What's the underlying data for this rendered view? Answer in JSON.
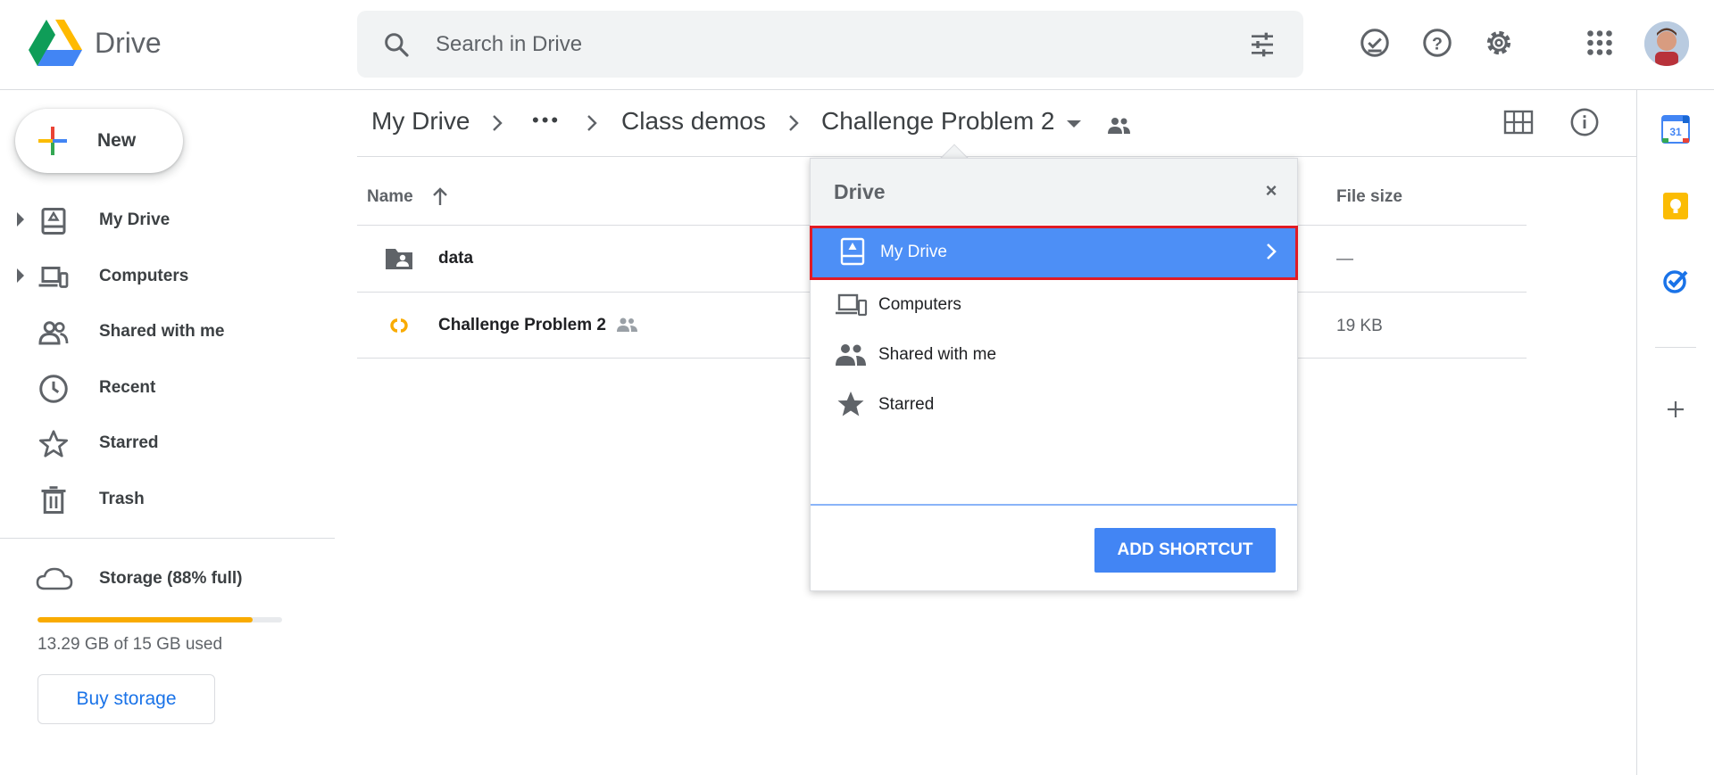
{
  "header": {
    "app_name": "Drive",
    "search_placeholder": "Search in Drive",
    "icons": [
      "drive-logo",
      "search-icon",
      "tune-icon",
      "ready-for-offline-icon",
      "help-icon",
      "settings-icon",
      "apps-grid-icon",
      "avatar"
    ]
  },
  "sidebar": {
    "new_label": "New",
    "items": [
      {
        "label": "My Drive",
        "icon": "my-drive-icon"
      },
      {
        "label": "Computers",
        "icon": "computers-icon"
      },
      {
        "label": "Shared with me",
        "icon": "shared-with-me-icon"
      },
      {
        "label": "Recent",
        "icon": "clock-icon"
      },
      {
        "label": "Starred",
        "icon": "star-outline-icon"
      },
      {
        "label": "Trash",
        "icon": "trash-icon"
      }
    ],
    "storage_label": "Storage (88% full)",
    "storage_percent": 88,
    "storage_used": "13.29 GB of 15 GB used",
    "buy_storage": "Buy storage"
  },
  "breadcrumb": {
    "items": [
      "My Drive",
      "•••",
      "Class demos",
      "Challenge Problem 2"
    ]
  },
  "file_list": {
    "columns": {
      "name": "Name",
      "size": "File size"
    },
    "rows": [
      {
        "name": "data",
        "type": "shared-folder",
        "size": "—",
        "shared": false
      },
      {
        "name": "Challenge Problem 2",
        "type": "colab",
        "size": "19 KB",
        "shared": true
      }
    ]
  },
  "popup": {
    "title": "Drive",
    "close": "×",
    "items": [
      {
        "label": "My Drive",
        "icon": "my-drive-icon",
        "selected": true
      },
      {
        "label": "Computers",
        "icon": "computers-icon",
        "selected": false
      },
      {
        "label": "Shared with me",
        "icon": "shared-with-me-icon",
        "selected": false
      },
      {
        "label": "Starred",
        "icon": "star-icon",
        "selected": false
      }
    ],
    "add_shortcut": "ADD SHORTCUT"
  },
  "right_rail": {
    "icons": [
      "calendar-icon",
      "keep-icon",
      "tasks-icon",
      "add-addon-icon"
    ],
    "calendar_day": "31"
  },
  "colors": {
    "accent_blue": "#1a73e8",
    "selected_row": "#4d8ff6",
    "highlight_border": "#e01b24",
    "storage_bar": "#f9ab00"
  }
}
